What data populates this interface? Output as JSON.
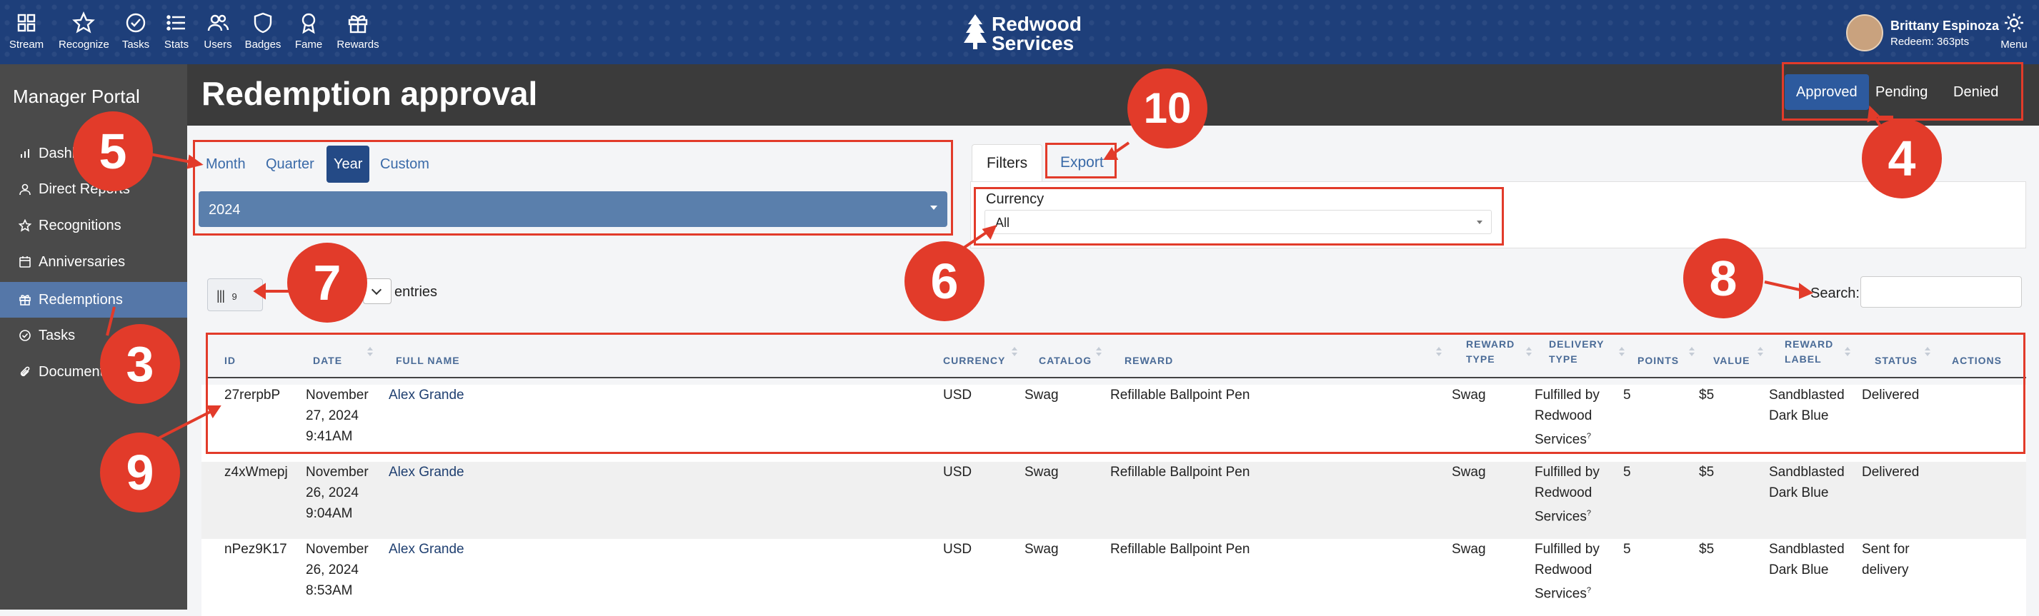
{
  "topnav": {
    "items": [
      {
        "label": "Stream",
        "icon": "grid-icon"
      },
      {
        "label": "Recognize",
        "icon": "star-icon"
      },
      {
        "label": "Tasks",
        "icon": "check-circle-icon"
      },
      {
        "label": "Stats",
        "icon": "list-icon"
      },
      {
        "label": "Users",
        "icon": "users-icon"
      },
      {
        "label": "Badges",
        "icon": "shield-icon"
      },
      {
        "label": "Fame",
        "icon": "award-icon"
      },
      {
        "label": "Rewards",
        "icon": "gift-icon"
      }
    ],
    "logo_line1": "Redwood",
    "logo_line2": "Services",
    "user_name": "Brittany Espinoza",
    "user_points": "Redeem: 363pts",
    "menu_label": "Menu"
  },
  "sidebar": {
    "portal_title": "Manager Portal",
    "items": [
      {
        "label": "Dashb",
        "icon": "bar-chart-icon"
      },
      {
        "label": "Direct Reports",
        "icon": "user-icon"
      },
      {
        "label": "Recognitions",
        "icon": "star-icon"
      },
      {
        "label": "Anniversaries",
        "icon": "calendar-icon"
      },
      {
        "label": "Redemptions",
        "icon": "gift-icon"
      },
      {
        "label": "Tasks",
        "icon": "check-circle-icon"
      },
      {
        "label": "Document",
        "icon": "paperclip-icon"
      }
    ],
    "active_index": 4
  },
  "header": {
    "title": "Redemption approval",
    "tabs": [
      "Approved",
      "Pending",
      "Denied"
    ],
    "active_tab": "Approved"
  },
  "period": {
    "options": [
      "Month",
      "Quarter",
      "Year",
      "Custom"
    ],
    "active": "Year",
    "year_value": "2024"
  },
  "filters": {
    "tabs": [
      "Filters",
      "Export"
    ],
    "currency_label": "Currency",
    "currency_value": "All"
  },
  "table_controls": {
    "columns_button": "9",
    "entries_label": "entries",
    "search_label": "Search:"
  },
  "table": {
    "headers": {
      "id": "ID",
      "date": "DATE",
      "full_name": "FULL NAME",
      "currency": "CURRENCY",
      "catalog": "CATALOG",
      "reward": "REWARD",
      "reward_type_1": "REWARD",
      "reward_type_2": "TYPE",
      "delivery_type_1": "DELIVERY",
      "delivery_type_2": "TYPE",
      "points": "POINTS",
      "value": "VALUE",
      "reward_label_1": "REWARD",
      "reward_label_2": "LABEL",
      "status": "STATUS",
      "actions": "ACTIONS"
    },
    "rows": [
      {
        "id": "27rerpbP",
        "date1": "November",
        "date2": "27, 2024",
        "date3": "9:41AM",
        "name": "Alex Grande",
        "currency": "USD",
        "catalog": "Swag",
        "reward": "Refillable Ballpoint Pen",
        "reward_type": "Swag",
        "delivery1": "Fulfilled by",
        "delivery2": "Redwood",
        "delivery3": "Services",
        "points": "5",
        "value": "$5",
        "label1": "Sandblasted",
        "label2": "Dark Blue",
        "status1": "Delivered",
        "status2": ""
      },
      {
        "id": "z4xWmepj",
        "date1": "November",
        "date2": "26, 2024",
        "date3": "9:04AM",
        "name": "Alex Grande",
        "currency": "USD",
        "catalog": "Swag",
        "reward": "Refillable Ballpoint Pen",
        "reward_type": "Swag",
        "delivery1": "Fulfilled by",
        "delivery2": "Redwood",
        "delivery3": "Services",
        "points": "5",
        "value": "$5",
        "label1": "Sandblasted",
        "label2": "Dark Blue",
        "status1": "Delivered",
        "status2": ""
      },
      {
        "id": "nPez9K17",
        "date1": "November",
        "date2": "26, 2024",
        "date3": "8:53AM",
        "name": "Alex Grande",
        "currency": "USD",
        "catalog": "Swag",
        "reward": "Refillable Ballpoint Pen",
        "reward_type": "Swag",
        "delivery1": "Fulfilled by",
        "delivery2": "Redwood",
        "delivery3": "Services",
        "points": "5",
        "value": "$5",
        "label1": "Sandblasted",
        "label2": "Dark Blue",
        "status1": "Sent for",
        "status2": "delivery"
      }
    ]
  },
  "annotations": [
    "3",
    "4",
    "5",
    "6",
    "7",
    "8",
    "9",
    "10"
  ],
  "colors": {
    "annotation": "#e23b2a",
    "nav": "#1e3f7a",
    "active": "#244a86"
  }
}
